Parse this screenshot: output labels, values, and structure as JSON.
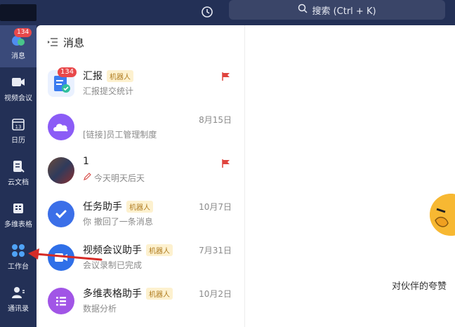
{
  "topbar": {
    "search_label": "搜索 (Ctrl + K)"
  },
  "rail": {
    "items": [
      {
        "label": "消息",
        "badge": "134",
        "icon": "message-icon"
      },
      {
        "label": "视频会议",
        "icon": "video-icon"
      },
      {
        "label": "日历",
        "icon": "calendar-icon",
        "icon_text": "13"
      },
      {
        "label": "云文档",
        "icon": "document-icon"
      },
      {
        "label": "多维表格",
        "icon": "table-icon"
      },
      {
        "label": "工作台",
        "icon": "apps-icon"
      },
      {
        "label": "通讯录",
        "icon": "contacts-icon"
      }
    ]
  },
  "panel": {
    "title": "消息",
    "messages": [
      {
        "title": "汇报",
        "tag": "机器人",
        "subtitle": "汇报提交统计",
        "date": "",
        "badge": "134",
        "flag": true
      },
      {
        "title": "",
        "tag": "",
        "subtitle": "[链接]员工管理制度",
        "date": "8月15日",
        "flag": false
      },
      {
        "title": "1",
        "tag": "",
        "subtitle": "今天明天后天",
        "date": "",
        "flag": true
      },
      {
        "title": "任务助手",
        "tag": "机器人",
        "subtitle": "你 撤回了一条消息",
        "date": "10月7日",
        "flag": false
      },
      {
        "title": "视频会议助手",
        "tag": "机器人",
        "subtitle": "会议录制已完成",
        "date": "7月31日",
        "flag": false
      },
      {
        "title": "多维表格助手",
        "tag": "机器人",
        "subtitle": "数据分析",
        "date": "10月2日",
        "flag": false
      }
    ]
  },
  "right": {
    "text": "对伙伴的夸赞"
  },
  "colors": {
    "rail_bg": "#233056",
    "active_bg": "#3a4a7a",
    "badge": "#e8484a",
    "flag": "#e0443e",
    "arrow": "#d52b27"
  }
}
